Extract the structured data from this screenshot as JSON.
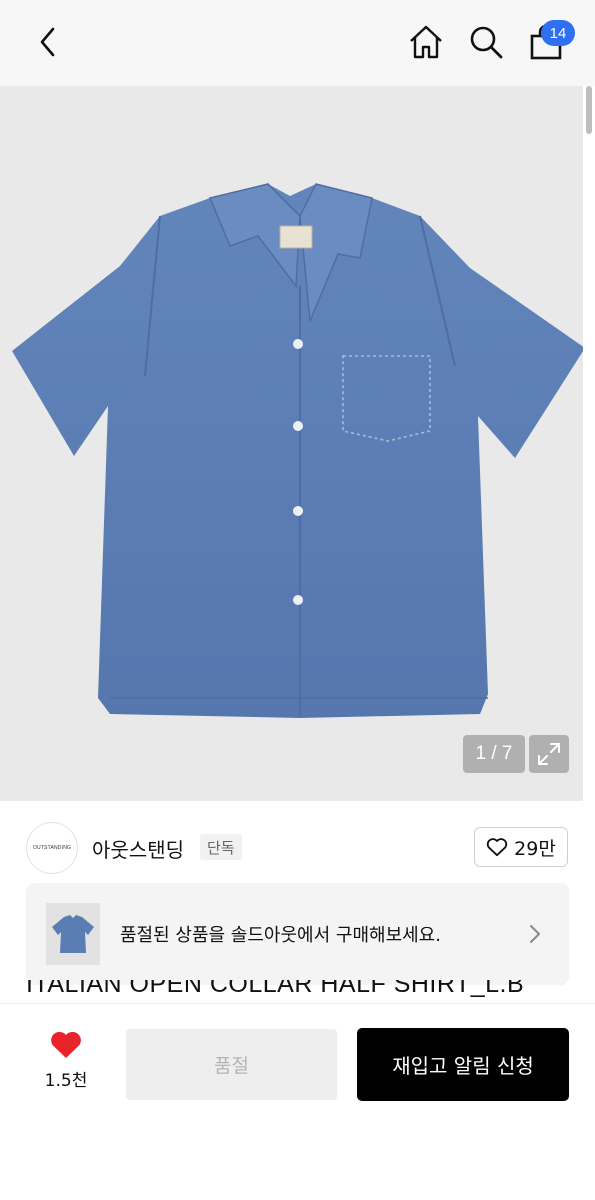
{
  "header": {
    "back_icon": "chevron-left-icon",
    "home_icon": "home-icon",
    "search_icon": "search-icon",
    "cart_icon": "shopping-bag-icon",
    "cart_count": "14",
    "badge_color": "#2f6ff2"
  },
  "gallery": {
    "counter": "1 / 7",
    "expand_icon": "expand-icon",
    "background": "#e9e9e9",
    "product_color": "#5a7db3"
  },
  "brand": {
    "logo_text": "OUTSTANDING",
    "name": "아웃스탠딩",
    "tag": "단독",
    "like_count": "29만"
  },
  "soldout_banner": {
    "message": "품절된 상품을 솔드아웃에서 구매해보세요.",
    "chevron_icon": "chevron-right-icon"
  },
  "product": {
    "title": "ITALIAN OPEN COLLAR HALF SHIRT_L.B"
  },
  "bottom_bar": {
    "wish_count": "1.5천",
    "heart_color": "#e8242a",
    "disabled_label": "품절",
    "primary_label": "재입고 알림 신청"
  }
}
